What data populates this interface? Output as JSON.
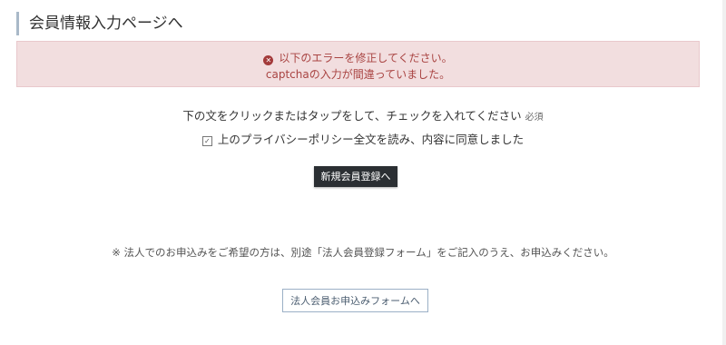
{
  "header": {
    "title": "会員情報入力ページへ"
  },
  "error": {
    "icon": "error-circle-icon",
    "line1": "以下のエラーを修正してください。",
    "line2": "captchaの入力が間違っていました。"
  },
  "consent": {
    "instruction": "下の文をクリックまたはタップをして、チェックを入れてください",
    "required_badge": "必須",
    "checkbox_label": "上のプライバシーポリシー全文を読み、内容に同意しました",
    "checked": true
  },
  "actions": {
    "register_label": "新規会員登録へ",
    "corporate_note": "※ 法人でのお申込みをご希望の方は、別途「法人会員登録フォーム」をご記入のうえ、お申込みください。",
    "corporate_label": "法人会員お申込みフォームへ"
  },
  "colors": {
    "error_bg": "#f2dedf",
    "error_text": "#a94442",
    "primary_button": "#2b2f33",
    "outline_button": "#9bb0c6"
  }
}
